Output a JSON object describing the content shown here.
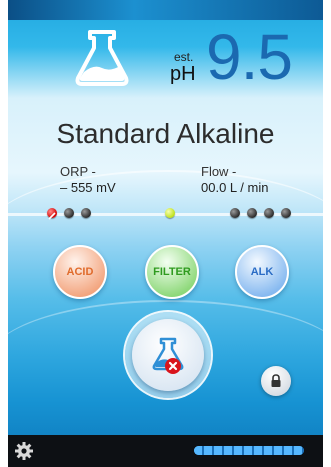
{
  "display": {
    "est_label": "est.",
    "ph_label": "pH",
    "ph_value": "9.5",
    "mode_title": "Standard Alkaline",
    "orp_label": "ORP -",
    "orp_value": "– 555  mV",
    "flow_label": "Flow -",
    "flow_value": "00.0  L / min"
  },
  "mode_buttons": {
    "acid": "ACID",
    "filter": "FILTER",
    "alk": "ALK"
  },
  "indicators": {
    "states": [
      "red-blocked",
      "dark",
      "dark",
      "green",
      "dark",
      "dark",
      "dark",
      "dark"
    ]
  },
  "progress": {
    "level": 1.0
  },
  "colors": {
    "ph_value": "#1b69b0",
    "acid": "#e06b2c",
    "filter": "#2f9b1f",
    "alk": "#2a6cc5",
    "stop": "#d9141c"
  },
  "icons": {
    "top": "beaker-icon",
    "main": "beaker-stop-icon",
    "lock": "lock-icon",
    "settings": "gear-icon"
  }
}
